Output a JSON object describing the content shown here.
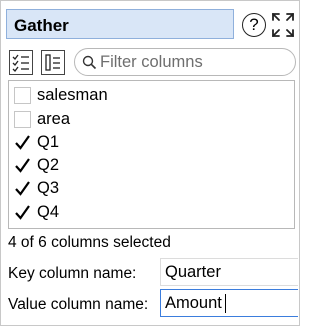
{
  "header": {
    "title": "Gather"
  },
  "toolbar": {
    "filter_placeholder": "Filter columns"
  },
  "columns": [
    {
      "label": "salesman",
      "checked": false
    },
    {
      "label": "area",
      "checked": false
    },
    {
      "label": "Q1",
      "checked": true
    },
    {
      "label": "Q2",
      "checked": true
    },
    {
      "label": "Q3",
      "checked": true
    },
    {
      "label": "Q4",
      "checked": true
    }
  ],
  "status": "4 of 6 columns selected",
  "key_field": {
    "label": "Key column name:",
    "value": "Quarter"
  },
  "value_field": {
    "label": "Value column name:",
    "value": "Amount"
  },
  "icons": {
    "help": "help-icon",
    "expand": "expand-icon",
    "check_all": "checklist-icon",
    "select_none": "list-icon",
    "search": "search-icon",
    "check": "checkmark-icon"
  },
  "colors": {
    "titlebar_bg": "#d9e6f7",
    "titlebar_border": "#8fb0dc",
    "focus": "#3b7ddd"
  }
}
